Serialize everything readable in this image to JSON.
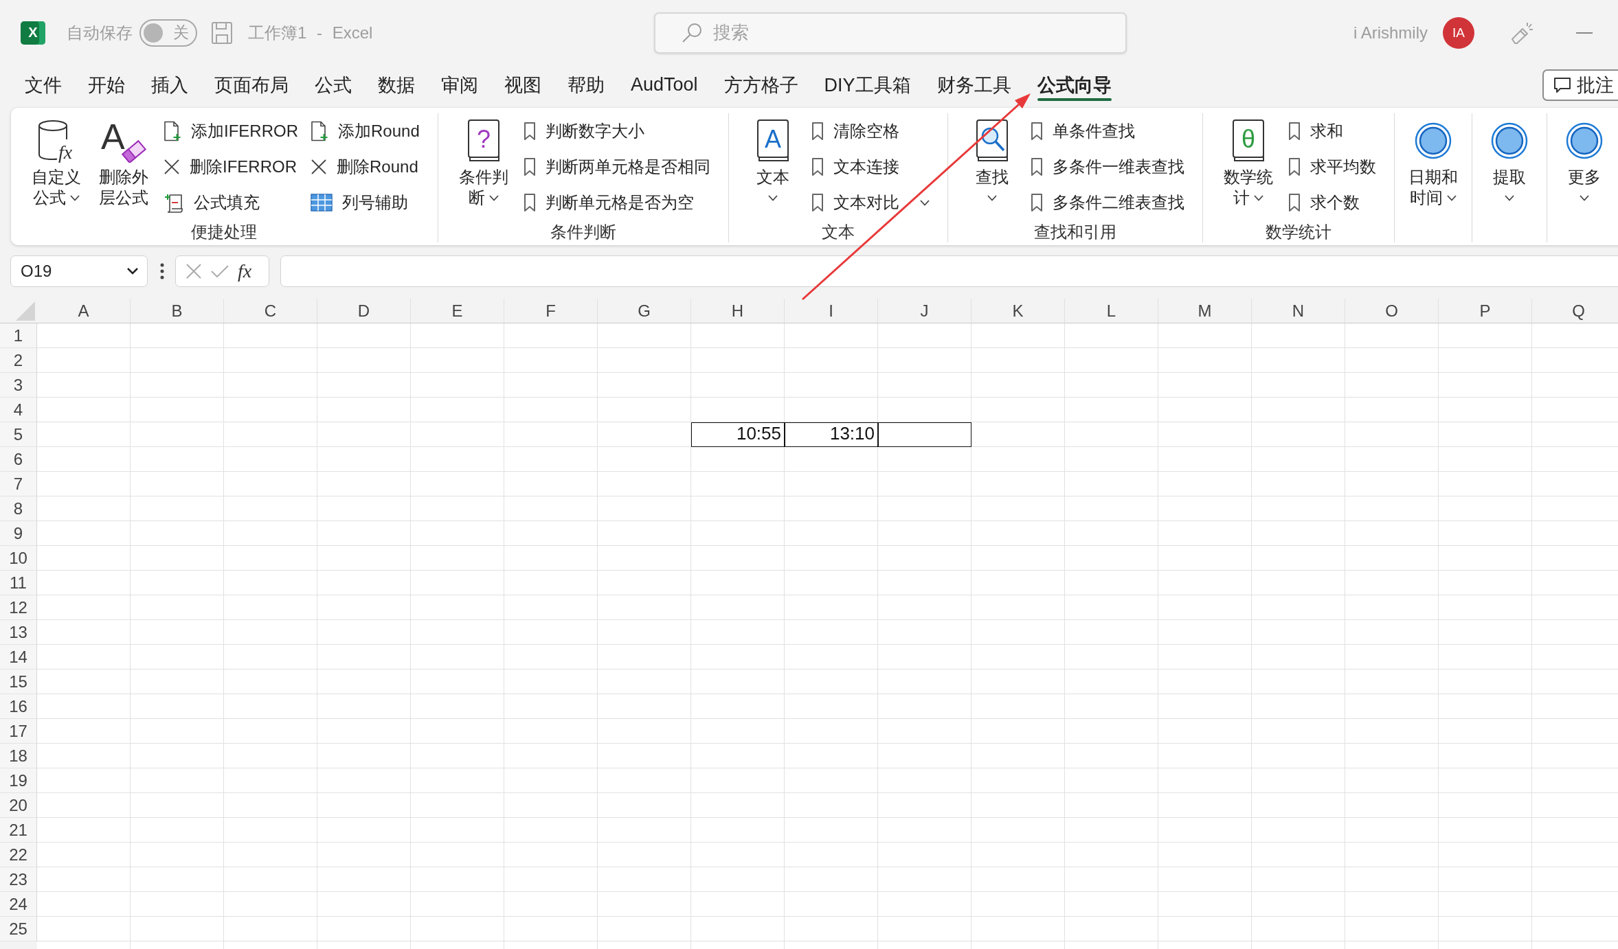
{
  "window": {
    "logo": "X",
    "autosave_label": "自动保存",
    "autosave": {
      "on": false,
      "label": "关"
    },
    "title": "工作簿1 - Excel",
    "search": {
      "placeholder": "搜索"
    },
    "user": {
      "name": "i Arishmily",
      "initials": "IA"
    }
  },
  "tabs": [
    {
      "label": "文件",
      "selected": false
    },
    {
      "label": "开始",
      "selected": false
    },
    {
      "label": "插入",
      "selected": false
    },
    {
      "label": "页面布局",
      "selected": false
    },
    {
      "label": "公式",
      "selected": false
    },
    {
      "label": "数据",
      "selected": false
    },
    {
      "label": "审阅",
      "selected": false
    },
    {
      "label": "视图",
      "selected": false
    },
    {
      "label": "帮助",
      "selected": false
    },
    {
      "label": "AudTool",
      "selected": false
    },
    {
      "label": "方方格子",
      "selected": false
    },
    {
      "label": "DIY工具箱",
      "selected": false
    },
    {
      "label": "财务工具",
      "selected": false
    },
    {
      "label": "公式向导",
      "selected": true
    }
  ],
  "comments_button": {
    "label": "批注"
  },
  "ribbon": {
    "groups": [
      {
        "label": "便捷处理",
        "items": [
          {
            "kind": "cylinder",
            "icon_text": "fx",
            "lines": [
              "自定义",
              "公式"
            ],
            "dropdown": true
          },
          {
            "kind": "eraser",
            "icon_text": "A",
            "lines": [
              "删除外",
              "层公式"
            ],
            "dropdown": false
          },
          {
            "kind": "newdoc",
            "label": "添加IFERROR",
            "dropdown": false
          },
          {
            "kind": "remove",
            "label": "删除IFERROR",
            "dropdown": false
          },
          {
            "kind": "fill",
            "label": "公式填充",
            "dropdown": false
          },
          {
            "kind": "newdoc",
            "label": "添加Round",
            "dropdown": false
          },
          {
            "kind": "remove",
            "label": "删除Round",
            "dropdown": false
          },
          {
            "kind": "grid",
            "label": "列号辅助",
            "dropdown": false
          }
        ]
      },
      {
        "label": "条件判断",
        "items": [
          {
            "kind": "quiz",
            "icon_text": "?",
            "lines": [
              "条件判",
              "断"
            ],
            "dropdown": true
          },
          {
            "kind": "bookmark",
            "label": "判断数字大小",
            "dropdown": false
          },
          {
            "kind": "bookmark",
            "label": "判断两单元格是否相同",
            "dropdown": false
          },
          {
            "kind": "bookmark",
            "label": "判断单元格是否为空",
            "dropdown": false
          }
        ]
      },
      {
        "label": "文本",
        "items": [
          {
            "kind": "letterbook",
            "icon_text": "A",
            "lines": [
              "文本"
            ],
            "dropdown": true
          },
          {
            "kind": "bookmark",
            "label": "清除空格",
            "dropdown": false
          },
          {
            "kind": "bookmark",
            "label": "文本连接",
            "dropdown": false
          },
          {
            "kind": "bookmark",
            "label": "文本对比",
            "dropdown": true
          }
        ]
      },
      {
        "label": "查找和引用",
        "items": [
          {
            "kind": "lookup",
            "lines": [
              "查找"
            ],
            "dropdown": true
          },
          {
            "kind": "bookmark",
            "label": "单条件查找",
            "dropdown": false
          },
          {
            "kind": "bookmark",
            "label": "多条件一维表查找",
            "dropdown": false
          },
          {
            "kind": "bookmark",
            "label": "多条件二维表查找",
            "dropdown": false
          }
        ]
      },
      {
        "label": "数学统计",
        "items": [
          {
            "kind": "mathbook",
            "icon_text": "θ",
            "lines": [
              "数学统",
              "计"
            ],
            "dropdown": true
          },
          {
            "kind": "bookmark",
            "label": "求和",
            "dropdown": false
          },
          {
            "kind": "bookmark",
            "label": "求平均数",
            "dropdown": false
          },
          {
            "kind": "bookmark",
            "label": "求个数",
            "dropdown": false
          }
        ]
      },
      {
        "items": [
          {
            "kind": "circle",
            "lines": [
              "日期和",
              "时间"
            ],
            "dropdown": true
          }
        ]
      },
      {
        "items": [
          {
            "kind": "circle",
            "lines": [
              "提取"
            ],
            "dropdown": true
          }
        ]
      },
      {
        "items": [
          {
            "kind": "circle",
            "lines": [
              "更多"
            ],
            "dropdown": true
          }
        ]
      }
    ]
  },
  "formula_bar": {
    "name_box": "O19",
    "function_label": "fx"
  },
  "sheet": {
    "columns": [
      "A",
      "B",
      "C",
      "D",
      "E",
      "F",
      "G",
      "H",
      "I",
      "J",
      "K",
      "L",
      "M",
      "N",
      "O",
      "P",
      "Q"
    ],
    "rows": [
      {
        "label": "1"
      },
      {
        "label": "2"
      },
      {
        "label": "3"
      },
      {
        "label": "4"
      },
      {
        "label": "5",
        "cells": [
          {
            "bordered": false
          },
          {
            "bordered": false
          },
          {
            "bordered": false
          },
          {
            "bordered": false
          },
          {
            "bordered": false
          },
          {
            "bordered": false
          },
          {
            "bordered": false
          },
          {
            "value": "10:55",
            "bordered": true
          },
          {
            "value": "13:10",
            "bordered": true
          },
          {
            "bordered": true
          }
        ]
      },
      {
        "label": "6"
      },
      {
        "label": "7"
      },
      {
        "label": "8"
      },
      {
        "label": "9"
      },
      {
        "label": "10"
      },
      {
        "label": "11"
      },
      {
        "label": "12"
      },
      {
        "label": "13"
      },
      {
        "label": "14"
      },
      {
        "label": "15"
      },
      {
        "label": "16"
      },
      {
        "label": "17"
      },
      {
        "label": "18"
      },
      {
        "label": "19"
      },
      {
        "label": "20"
      },
      {
        "label": "21"
      },
      {
        "label": "22"
      },
      {
        "label": "23"
      },
      {
        "label": "24"
      },
      {
        "label": "25"
      }
    ]
  }
}
